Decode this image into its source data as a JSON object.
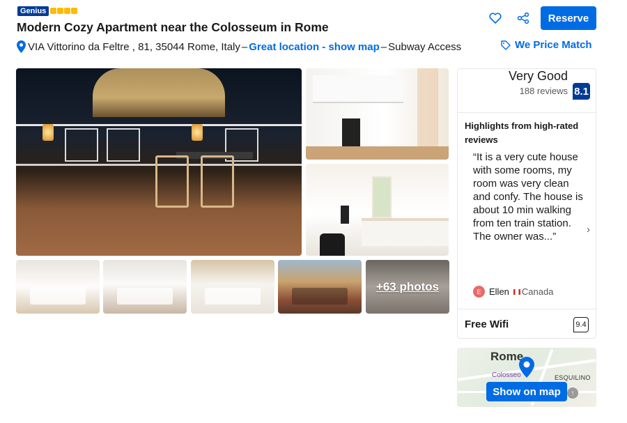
{
  "header": {
    "genius_badge": "Genius",
    "star_count": 4,
    "title": "Modern Cozy Apartment near the Colosseum in Rome",
    "address": "VIA Vittorino da Feltre , 81, 35044 Rome, Italy",
    "dash": "–",
    "great_location": "Great location - show map",
    "subway": "Subway Access",
    "reserve_label": "Reserve",
    "price_match_label": "We Price Match"
  },
  "gallery": {
    "more_photos": "+63 photos"
  },
  "review": {
    "rating_label": "Very Good",
    "reviews_count": "188 reviews",
    "score": "8.1",
    "highlights_title": "Highlights from high-rated reviews",
    "quote": "“It is a very cute house with some rooms, my room was very clean and confy. The house is about 10 min walking from ten train station. The owner was...”",
    "reviewer_initial": "E",
    "reviewer_name": "Ellen",
    "reviewer_country": "Canada",
    "wifi_label": "Free Wifi",
    "wifi_score": "9.4"
  },
  "map": {
    "city": "Rome",
    "district": "ESQUILINO",
    "poi": "Colosseo",
    "show_on_map": "Show on map"
  },
  "colors": {
    "brand_blue": "#006ce4",
    "dark_blue": "#003b95",
    "star_yellow": "#febb02"
  },
  "icons": [
    "pin-icon",
    "heart-icon",
    "share-icon",
    "tag-icon",
    "chevron-right-icon",
    "flag-icon",
    "map-pin-icon"
  ]
}
